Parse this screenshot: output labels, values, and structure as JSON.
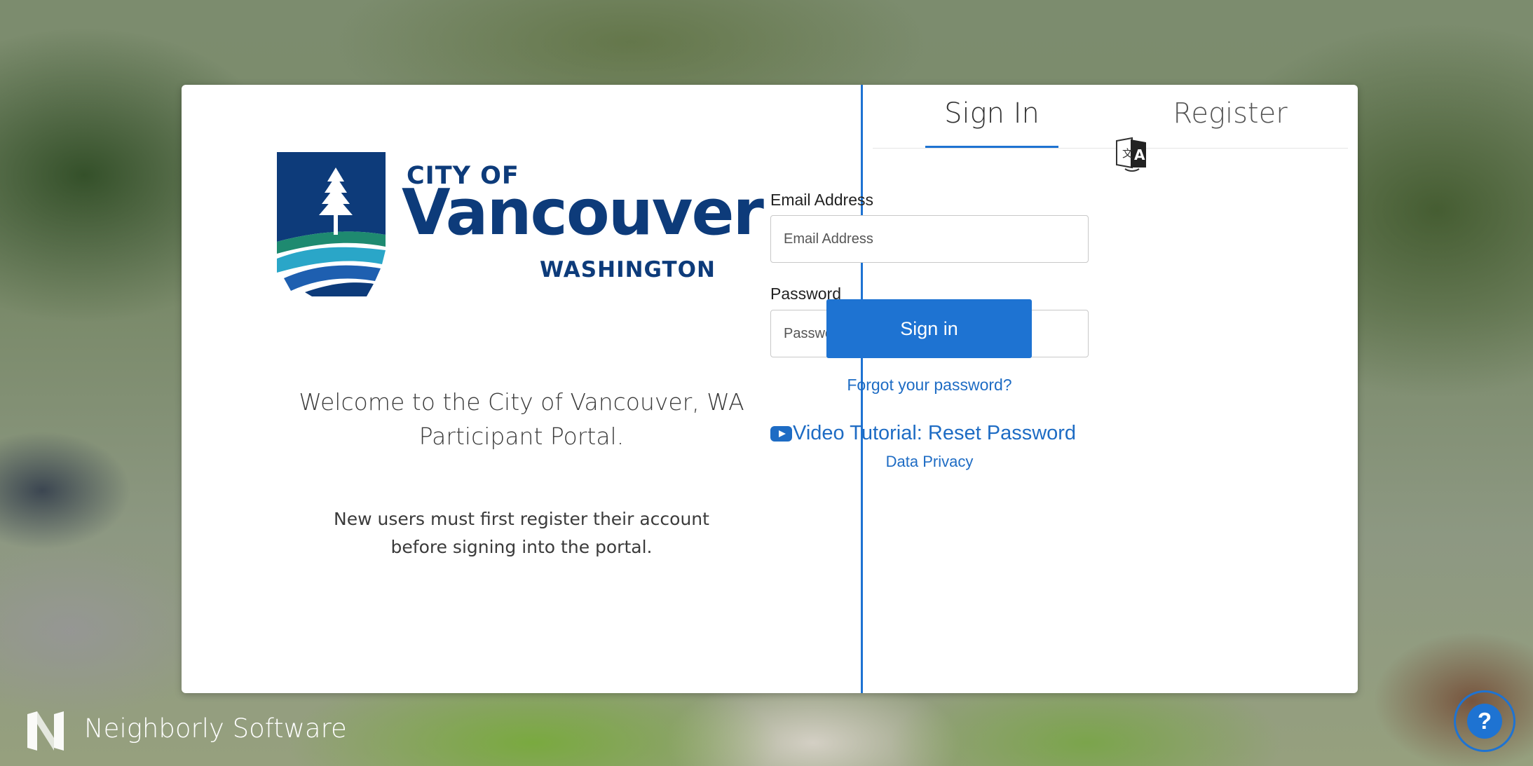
{
  "branding": {
    "city_of": "CITY OF",
    "city_name": "Vancouver",
    "state": "WASHINGTON",
    "brand_color": "#0d3b7a",
    "accent_color": "#1e73d2"
  },
  "welcome": {
    "line1": "Welcome to the City of Vancouver, WA",
    "line2": "Participant Portal.",
    "note_line1": "New users must first register their account",
    "note_line2": "before signing into the portal."
  },
  "tabs": {
    "signin": "Sign In",
    "register": "Register",
    "active": "signin"
  },
  "form": {
    "email_label": "Email Address",
    "email_placeholder": "Email Address",
    "email_value": "",
    "password_label": "Password",
    "password_placeholder": "Password",
    "password_value": "",
    "submit_label": "Sign in",
    "forgot_label": "Forgot your password?",
    "video_label": "Video Tutorial: Reset Password",
    "privacy_label": "Data Privacy",
    "translate_icon": "translate-icon"
  },
  "footer": {
    "vendor": "Neighborly Software",
    "help_symbol": "?"
  }
}
